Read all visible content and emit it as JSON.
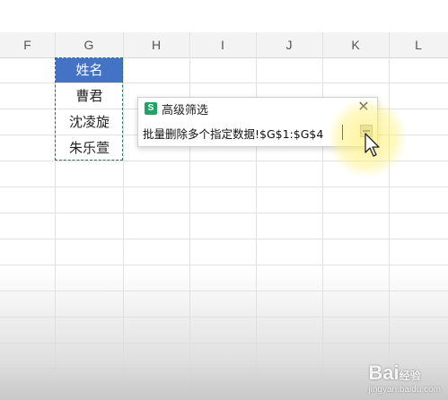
{
  "spreadsheet": {
    "column_headers": [
      "F",
      "G",
      "H",
      "I",
      "J",
      "K",
      "L"
    ],
    "cells": [
      "姓名",
      "曹君",
      "沈凌旋",
      "朱乐萱"
    ]
  },
  "dialog": {
    "icon_label": "S",
    "title": "高级筛选",
    "close_label": "✕",
    "range_value": "批量删除多个指定数据!$G$1:$G$4"
  },
  "watermark": {
    "brand": "Bai",
    "brand_suffix": "经验",
    "url": "jingyan.baidu.com"
  }
}
